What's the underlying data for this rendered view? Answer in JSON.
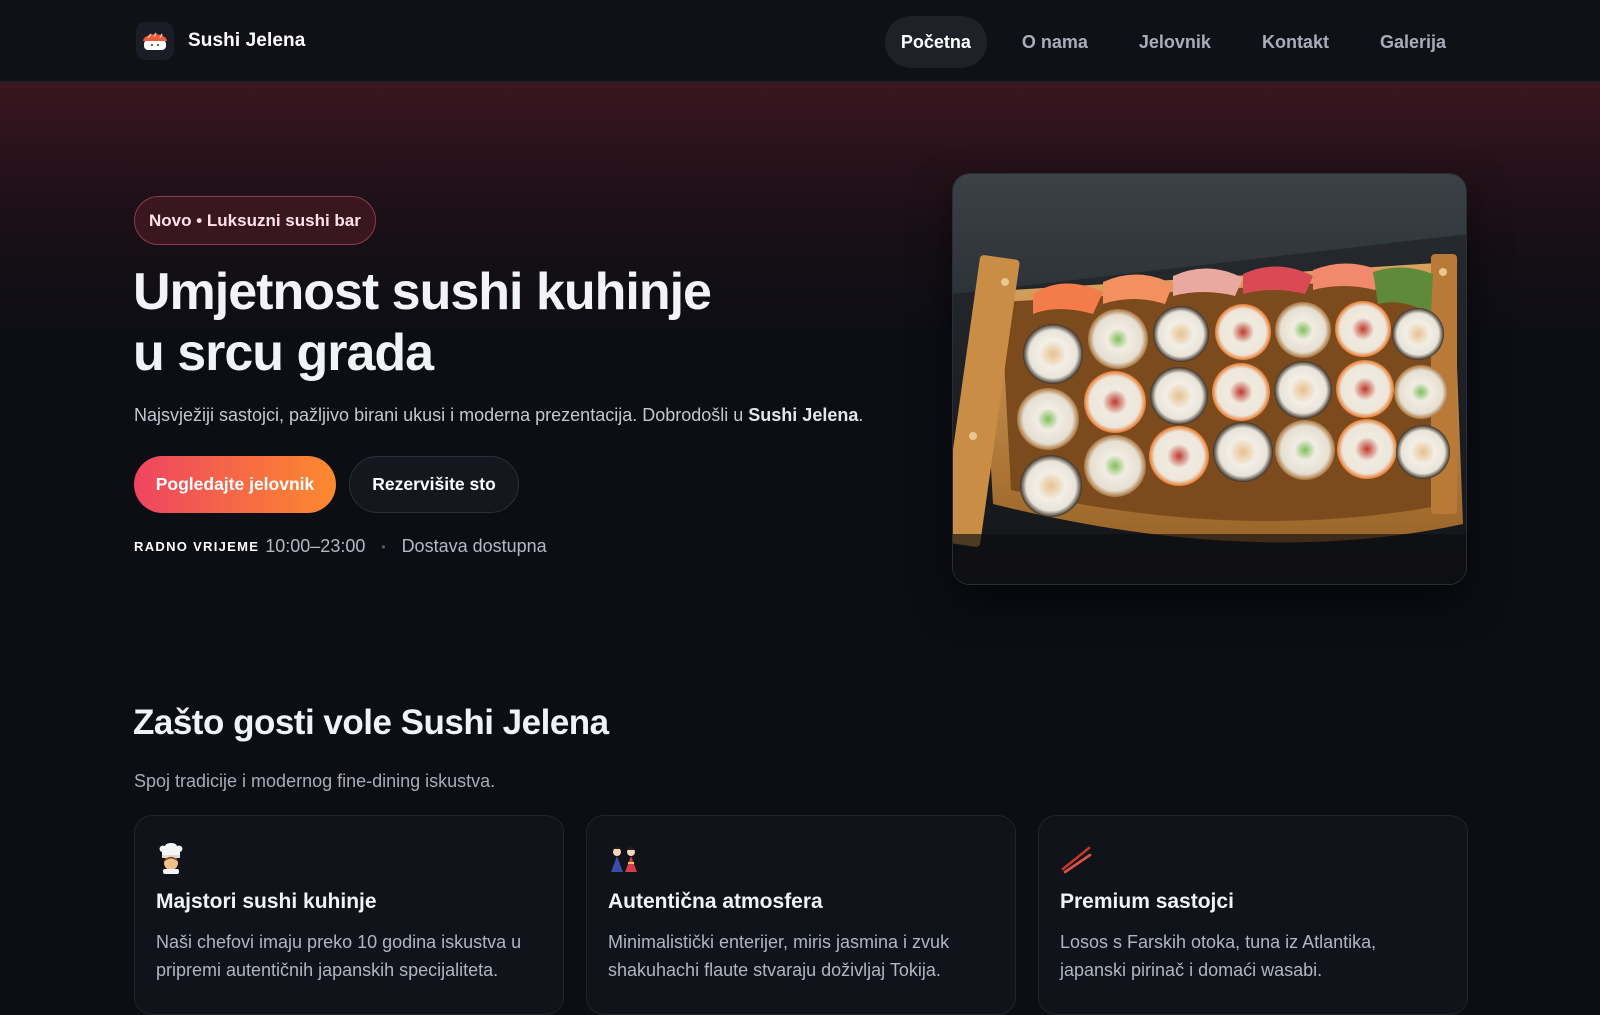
{
  "header": {
    "brand_name": "Sushi Jelena",
    "nav": [
      {
        "label": "Početna",
        "active": true
      },
      {
        "label": "O nama",
        "active": false
      },
      {
        "label": "Jelovnik",
        "active": false
      },
      {
        "label": "Kontakt",
        "active": false
      },
      {
        "label": "Galerija",
        "active": false
      }
    ]
  },
  "hero": {
    "badge": "Novo • Luksuzni sushi bar",
    "title_line1": "Umjetnost sushi kuhinje",
    "title_line2": "u srcu grada",
    "subtitle_prefix": "Najsvježiji sastojci, pažljivo birani ukusi i moderna prezentacija. Dobrodošli u",
    "subtitle_brand": "Sushi Jelena",
    "subtitle_suffix": ".",
    "primary_button": "Pogledajte jelovnik",
    "secondary_button": "Rezervišite sto",
    "hours_label": "RADNO VRIJEME",
    "hours_value": "10:00–23:00",
    "separator": "•",
    "delivery": "Dostava dostupna",
    "image": "sushi-boat-photo"
  },
  "features": {
    "title": "Zašto gosti vole Sushi Jelena",
    "subtitle": "Spoj tradicije i modernog fine-dining iskustva.",
    "cards": [
      {
        "icon": "chef-icon",
        "title": "Majstori sushi kuhinje",
        "text": "Naši chefovi imaju preko 10 godina iskustva u pripremi autentičnih japanskih specijaliteta."
      },
      {
        "icon": "dolls-icon",
        "title": "Autentična atmosfera",
        "text": "Minimalistički enterijer, miris jasmina i zvuk shakuhachi flaute stvaraju doživljaj Tokija."
      },
      {
        "icon": "chopsticks-icon",
        "title": "Premium sastojci",
        "text": "Losos s Farskih otoka, tuna iz Atlantika, japanski pirinač i domaći wasabi."
      }
    ]
  },
  "colors": {
    "accent_start": "#ef4560",
    "accent_end": "#fb8a2e",
    "background": "#0c0e14"
  }
}
